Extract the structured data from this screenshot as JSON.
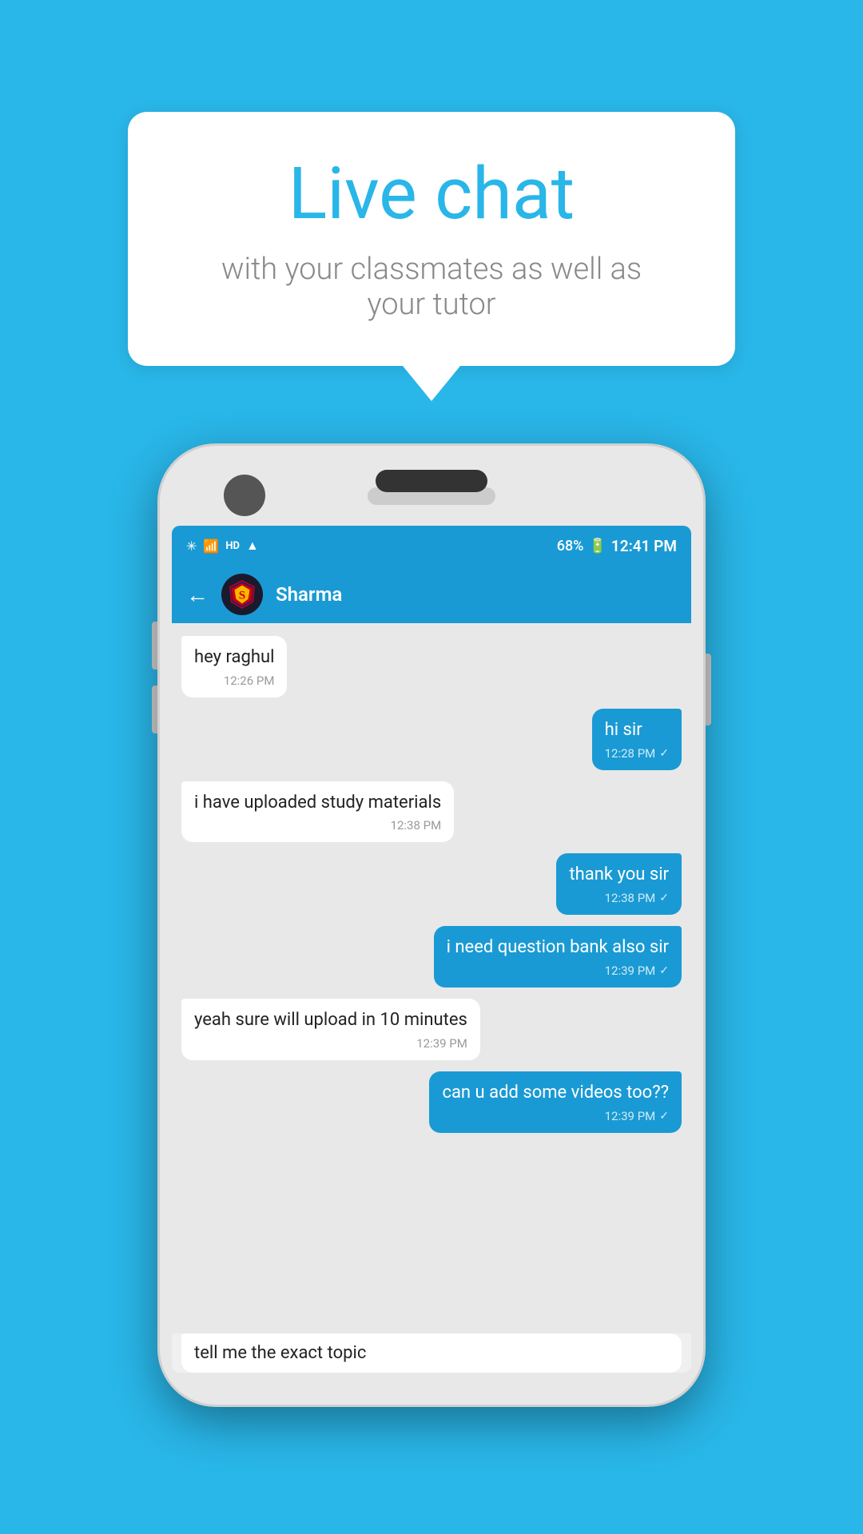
{
  "background": {
    "color": "#29b6e8"
  },
  "speech_bubble": {
    "title": "Live chat",
    "subtitle": "with your classmates as well as your tutor"
  },
  "phone": {
    "status_bar": {
      "time": "12:41 PM",
      "battery": "68%",
      "icons": "bluetooth signal wifi network"
    },
    "header": {
      "contact_name": "Sharma",
      "back_label": "←"
    },
    "messages": [
      {
        "id": "msg1",
        "type": "received",
        "text": "hey raghul",
        "time": "12:26 PM",
        "tick": ""
      },
      {
        "id": "msg2",
        "type": "sent",
        "text": "hi sir",
        "time": "12:28 PM",
        "tick": "✓"
      },
      {
        "id": "msg3",
        "type": "received",
        "text": "i have uploaded study materials",
        "time": "12:38 PM",
        "tick": ""
      },
      {
        "id": "msg4",
        "type": "sent",
        "text": "thank you sir",
        "time": "12:38 PM",
        "tick": "✓"
      },
      {
        "id": "msg5",
        "type": "sent",
        "text": "i need question bank also sir",
        "time": "12:39 PM",
        "tick": "✓"
      },
      {
        "id": "msg6",
        "type": "received",
        "text": "yeah sure will upload in 10 minutes",
        "time": "12:39 PM",
        "tick": ""
      },
      {
        "id": "msg7",
        "type": "sent",
        "text": "can u add some videos too??",
        "time": "12:39 PM",
        "tick": "✓"
      }
    ],
    "partial_message": {
      "text": "tell me the exact topic"
    }
  }
}
